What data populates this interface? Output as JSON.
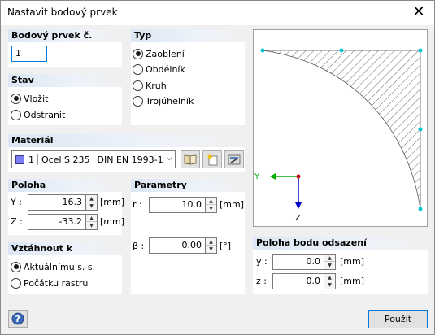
{
  "window": {
    "title": "Nastavit bodový prvek"
  },
  "number": {
    "header": "Bodový prvek č.",
    "value": "1"
  },
  "type": {
    "header": "Typ",
    "options": [
      "Zaoblení",
      "Obdélník",
      "Kruh",
      "Trojúhelník"
    ],
    "selected": "Zaoblení"
  },
  "state": {
    "header": "Stav",
    "options": [
      "Vložit",
      "Odstranit"
    ],
    "selected": "Vložit"
  },
  "material": {
    "header": "Materiál",
    "index": "1",
    "name": "Ocel S 235",
    "norm": "DIN EN 1993-1",
    "color": "#7b7bf2"
  },
  "position": {
    "header": "Poloha",
    "y_label": "Y :",
    "y_value": "16.3",
    "y_unit": "[mm]",
    "z_label": "Z :",
    "z_value": "-33.2",
    "z_unit": "[mm]"
  },
  "params": {
    "header": "Parametry",
    "r_label": "r :",
    "r_value": "10.0",
    "r_unit": "[mm]",
    "beta_label": "β :",
    "beta_value": "0.00",
    "beta_unit": "[°]"
  },
  "relative": {
    "header": "Vztáhnout k",
    "options": [
      "Aktuálnímu s. s.",
      "Počátku rastru"
    ],
    "selected": "Aktuálnímu s. s."
  },
  "offset": {
    "header": "Poloha bodu odsazení",
    "y_label": "y :",
    "y_value": "0.0",
    "y_unit": "[mm]",
    "z_label": "z :",
    "z_value": "0.0",
    "z_unit": "[mm]"
  },
  "preview": {
    "axis_y": "Y",
    "axis_z": "Z"
  },
  "footer": {
    "ok_label": "Použít"
  },
  "colors": {
    "accent": "#0078d7",
    "axis_y": "#00aa00",
    "axis_z": "#0000cc",
    "origin": "#cc0000",
    "node": "#00c8c8"
  }
}
